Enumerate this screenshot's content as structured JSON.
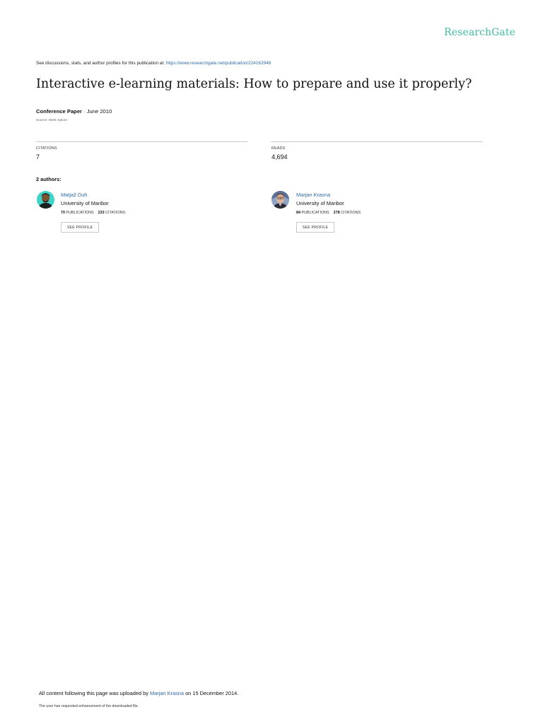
{
  "brand": {
    "logo_text": "ResearchGate",
    "accent_color": "#40ba9c",
    "link_color": "#2f6aa6"
  },
  "header": {
    "discuss_prefix": "See discussions, stats, and author profiles for this publication at: ",
    "publication_url": "https://www.researchgate.net/publication/224162948"
  },
  "paper": {
    "title": "Interactive e-learning materials: How to prepare and use it properly?",
    "type": "Conference Paper",
    "date_sep": " · June 2010",
    "source": "Source: IEEE Xplore"
  },
  "stats": {
    "citations_label": "CITATIONS",
    "citations_value": "7",
    "reads_label": "READS",
    "reads_value": "4,694"
  },
  "authors": {
    "heading": "2 authors:",
    "publications_label": "PUBLICATIONS",
    "citations_label": "CITATIONS",
    "see_profile_label": "SEE PROFILE",
    "list": [
      {
        "name": "Matjaž Duh",
        "institution": "University of Maribor",
        "publications": "70",
        "citations": "233"
      },
      {
        "name": "Marjan Krasna",
        "institution": "University of Maribor",
        "publications": "84",
        "citations": "278"
      }
    ]
  },
  "footer": {
    "upload_prefix": "All content following this page was uploaded by ",
    "uploader": "Marjan Krasna",
    "upload_suffix": " on 15 December 2014.",
    "request_note": "The user has requested enhancement of the downloaded file."
  }
}
